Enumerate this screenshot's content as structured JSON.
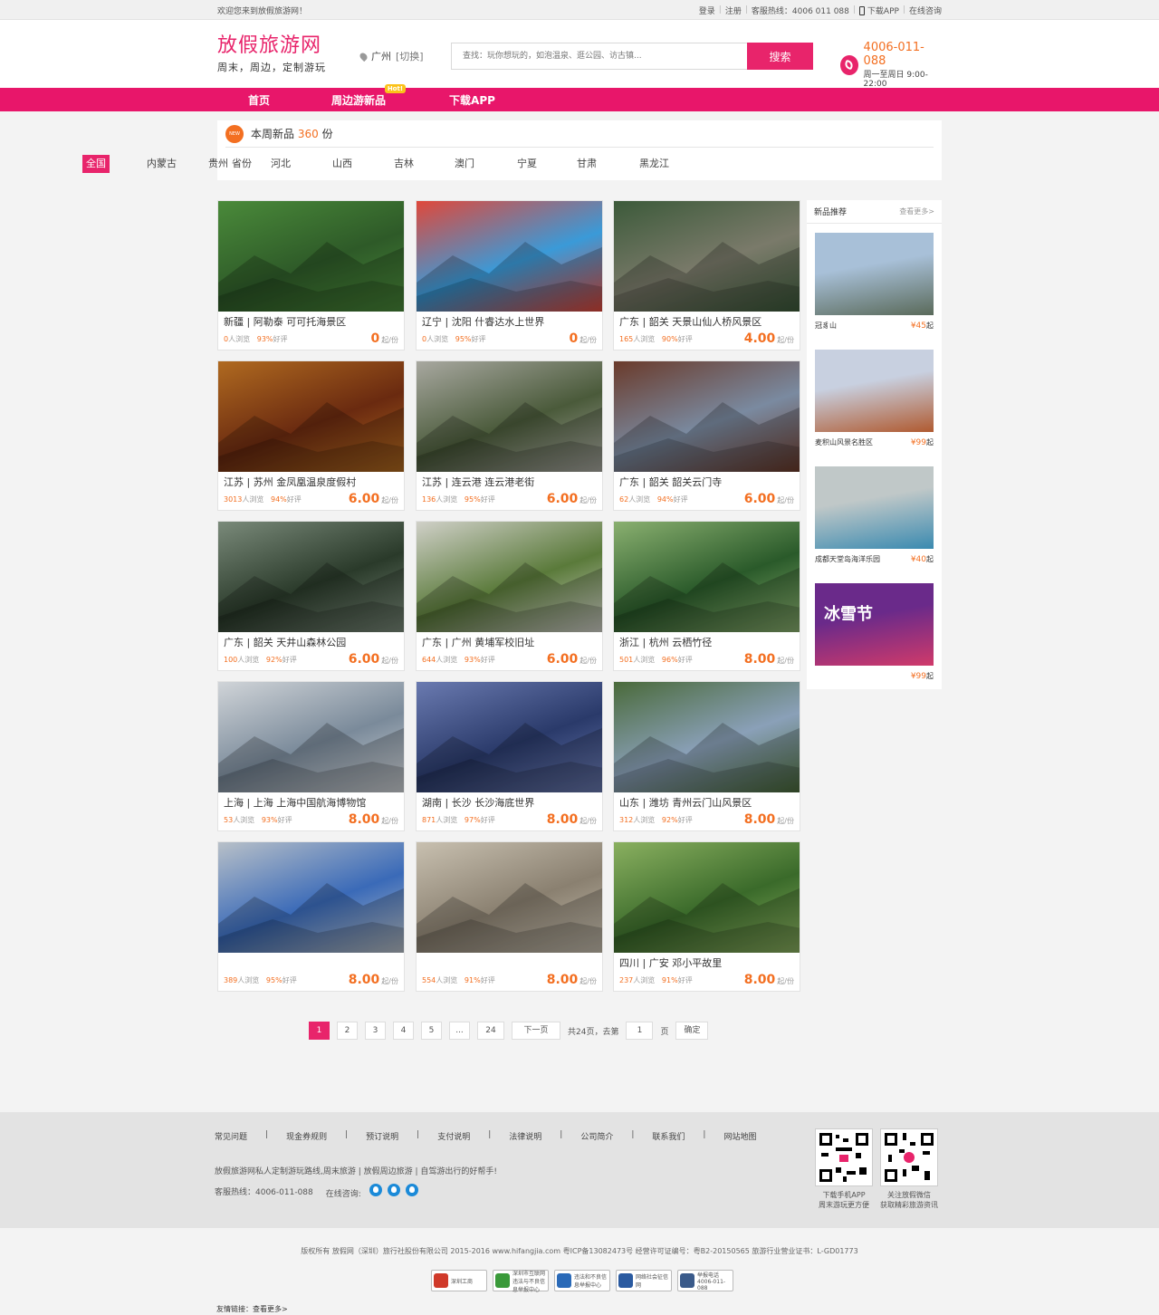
{
  "topbar": {
    "welcome": "欢迎您来到放假旅游网！",
    "login": "登录",
    "register": "注册",
    "hotline": "客服热线：4006 011 088",
    "download": "下载APP",
    "consult": "在线咨询"
  },
  "header": {
    "logo": "放假旅游网",
    "slogan": "周末，周边，定制游玩",
    "city": "广州",
    "switch": "[切换]",
    "search_placeholder": "查找：玩你想玩的，如泡温泉、逛公园、访古镇...",
    "search_button": "搜索",
    "phone": "4006-011-088",
    "hours": "周一至周日 9:00-22:00"
  },
  "nav": [
    {
      "label": "首页"
    },
    {
      "label": "周边游新品",
      "badge": "Hot!"
    },
    {
      "label": "下载APP"
    }
  ],
  "filter": {
    "title": "本周新品",
    "count": "360",
    "unit": "份",
    "new_icon": "NEW",
    "label": "省份",
    "provinces": [
      "全国",
      "内蒙古",
      "贵州",
      "河北",
      "山西",
      "吉林",
      "澳门",
      "宁夏",
      "甘肃",
      "黑龙江"
    ],
    "active": "全国"
  },
  "products": [
    {
      "name": "新疆 | 阿勒泰 可可托海景区",
      "views": "0",
      "views_label": "人浏览",
      "rate": "93%",
      "rate_label": "好评",
      "price": "0",
      "unit": "起/份"
    },
    {
      "name": "辽宁 | 沈阳 什睿达水上世界",
      "views": "0",
      "views_label": "人浏览",
      "rate": "95%",
      "rate_label": "好评",
      "price": "0",
      "unit": "起/份"
    },
    {
      "name": "广东 | 韶关 天景山仙人桥风景区",
      "views": "165",
      "views_label": "人浏览",
      "rate": "90%",
      "rate_label": "好评",
      "price": "4.00",
      "unit": "起/份"
    },
    {
      "name": "江苏 | 苏州 金凤凰温泉度假村",
      "views": "3013",
      "views_label": "人浏览",
      "rate": "94%",
      "rate_label": "好评",
      "price": "6.00",
      "unit": "起/份"
    },
    {
      "name": "江苏 | 连云港 连云港老街",
      "views": "136",
      "views_label": "人浏览",
      "rate": "95%",
      "rate_label": "好评",
      "price": "6.00",
      "unit": "起/份"
    },
    {
      "name": "广东 | 韶关 韶关云门寺",
      "views": "62",
      "views_label": "人浏览",
      "rate": "94%",
      "rate_label": "好评",
      "price": "6.00",
      "unit": "起/份"
    },
    {
      "name": "广东 | 韶关 天井山森林公园",
      "views": "100",
      "views_label": "人浏览",
      "rate": "92%",
      "rate_label": "好评",
      "price": "6.00",
      "unit": "起/份"
    },
    {
      "name": "广东 | 广州 黄埔军校旧址",
      "views": "644",
      "views_label": "人浏览",
      "rate": "93%",
      "rate_label": "好评",
      "price": "6.00",
      "unit": "起/份"
    },
    {
      "name": "浙江 | 杭州 云栖竹径",
      "views": "501",
      "views_label": "人浏览",
      "rate": "96%",
      "rate_label": "好评",
      "price": "8.00",
      "unit": "起/份"
    },
    {
      "name": "上海 | 上海 上海中国航海博物馆",
      "views": "53",
      "views_label": "人浏览",
      "rate": "93%",
      "rate_label": "好评",
      "price": "8.00",
      "unit": "起/份"
    },
    {
      "name": "湖南 | 长沙 长沙海底世界",
      "views": "871",
      "views_label": "人浏览",
      "rate": "97%",
      "rate_label": "好评",
      "price": "8.00",
      "unit": "起/份"
    },
    {
      "name": "山东 | 潍坊 青州云门山风景区",
      "views": "312",
      "views_label": "人浏览",
      "rate": "92%",
      "rate_label": "好评",
      "price": "8.00",
      "unit": "起/份"
    },
    {
      "name": "",
      "views": "389",
      "views_label": "人浏览",
      "rate": "95%",
      "rate_label": "好评",
      "price": "8.00",
      "unit": "起/份"
    },
    {
      "name": "",
      "views": "554",
      "views_label": "人浏览",
      "rate": "91%",
      "rate_label": "好评",
      "price": "8.00",
      "unit": "起/份"
    },
    {
      "name": "四川 | 广安 邓小平故里",
      "views": "237",
      "views_label": "人浏览",
      "rate": "91%",
      "rate_label": "好评",
      "price": "8.00",
      "unit": "起/份"
    }
  ],
  "product_colors": [
    [
      "#2e5a28",
      "#4a8a3a"
    ],
    [
      "#3a9ad8",
      "#e0483a"
    ],
    [
      "#7a7a6a",
      "#3c5a3a"
    ],
    [
      "#6a2a10",
      "#b06a20"
    ],
    [
      "#4a5a3a",
      "#a8a8a0"
    ],
    [
      "#7a8aa0",
      "#6a3a2a"
    ],
    [
      "#2a3a2a",
      "#7a8a7a"
    ],
    [
      "#5a7a3a",
      "#d0d0c8"
    ],
    [
      "#2a5a2a",
      "#8ab070"
    ],
    [
      "#7a8a9a",
      "#d0d4d8"
    ],
    [
      "#2a3a6a",
      "#6a7ab0"
    ],
    [
      "#8aa0b8",
      "#4a6a3a"
    ],
    [
      "#3a6ab8",
      "#b8c0c8"
    ],
    [
      "#8a8070",
      "#c8c0b0"
    ],
    [
      "#3a6a2a",
      "#8ab060"
    ]
  ],
  "sidebar": {
    "title": "新品推荐",
    "more": "查看更多>",
    "items": [
      {
        "name": "冠豸山",
        "price": "¥45",
        "unit": "起",
        "c1": "#a8c0d8",
        "c2": "#5a6a5a"
      },
      {
        "name": "麦积山风景名胜区",
        "price": "¥99",
        "unit": "起",
        "c1": "#c8d0e0",
        "c2": "#b05a30"
      },
      {
        "name": "成都天堂岛海洋乐园",
        "price": "¥40",
        "unit": "起",
        "c1": "#c0c8c8",
        "c2": "#3a8ab0"
      },
      {
        "name": "",
        "price": "¥99",
        "unit": "起",
        "c1": "#6a2a8a",
        "c2": "#d03a6a",
        "overlay": "冰雪节"
      }
    ]
  },
  "pager": {
    "pages": [
      "1",
      "2",
      "3",
      "4",
      "5",
      "...",
      "24"
    ],
    "next": "下一页",
    "total": "共24页，去第",
    "input": "1",
    "page": "页",
    "confirm": "确定"
  },
  "footer": {
    "links": [
      "常见问题",
      "现金券规则",
      "预订说明",
      "支付说明",
      "法律说明",
      "公司简介",
      "联系我们",
      "网站地图"
    ],
    "desc": "放假旅游网私人定制游玩路线,周末旅游 | 放假周边旅游 | 自驾游出行的好帮手!",
    "tel": "客服热线：4006-011-088",
    "consult": "在线咨询:",
    "qr1_line1": "下载手机APP",
    "qr1_line2": "周末游玩更方便",
    "qr2_line1": "关注放假微信",
    "qr2_line2": "获取精彩旅游资讯",
    "copyright": "版权所有 放假网（深圳）旅行社股份有限公司 2015-2016 www.hifangjia.com 粤ICP备13082473号  经营许可证编号：粤B2-20150565 旅游行业营业证书：L-GD01773",
    "badges": [
      "深圳工商",
      "深圳市互联网违法与不良信息举报中心",
      "违法和不良信息举报中心",
      "网络社会征信网",
      "举报电话 4006-011-088"
    ],
    "friend": "友情链接：查看更多>"
  }
}
